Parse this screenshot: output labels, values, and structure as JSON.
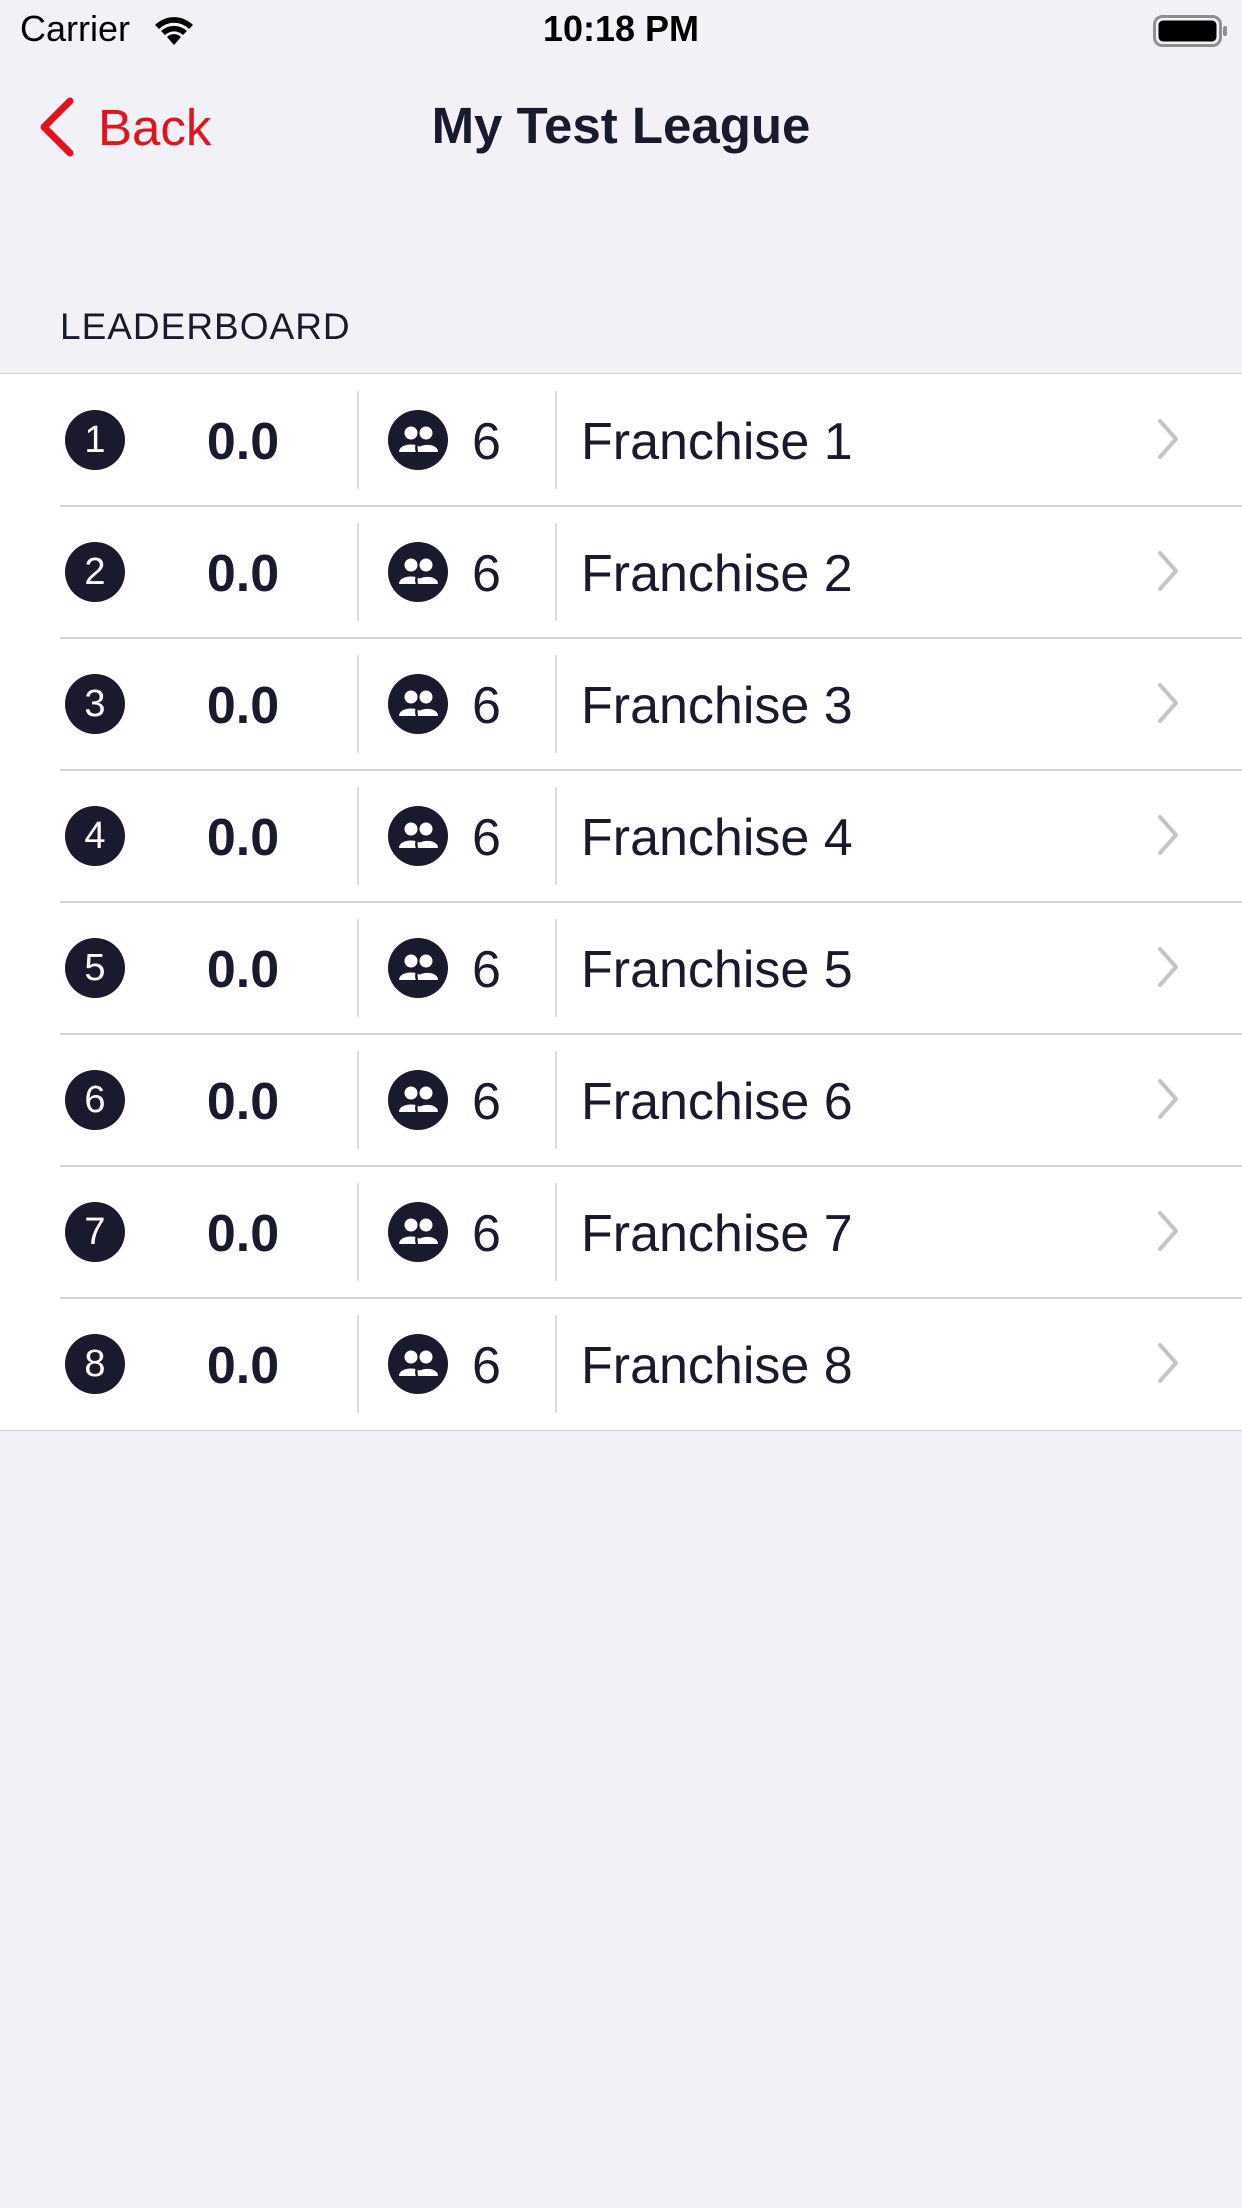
{
  "status_bar": {
    "carrier": "Carrier",
    "time": "10:18 PM"
  },
  "nav": {
    "back_label": "Back",
    "title": "My Test League"
  },
  "section": {
    "title": "LEADERBOARD"
  },
  "colors": {
    "accent": "#e0141e",
    "badge": "#1a1a2e",
    "background": "#f2f1f6"
  },
  "rows": [
    {
      "rank": "1",
      "score": "0.0",
      "members": "6",
      "name": "Franchise 1"
    },
    {
      "rank": "2",
      "score": "0.0",
      "members": "6",
      "name": "Franchise 2"
    },
    {
      "rank": "3",
      "score": "0.0",
      "members": "6",
      "name": "Franchise 3"
    },
    {
      "rank": "4",
      "score": "0.0",
      "members": "6",
      "name": "Franchise 4"
    },
    {
      "rank": "5",
      "score": "0.0",
      "members": "6",
      "name": "Franchise 5"
    },
    {
      "rank": "6",
      "score": "0.0",
      "members": "6",
      "name": "Franchise 6"
    },
    {
      "rank": "7",
      "score": "0.0",
      "members": "6",
      "name": "Franchise 7"
    },
    {
      "rank": "8",
      "score": "0.0",
      "members": "6",
      "name": "Franchise 8"
    }
  ]
}
